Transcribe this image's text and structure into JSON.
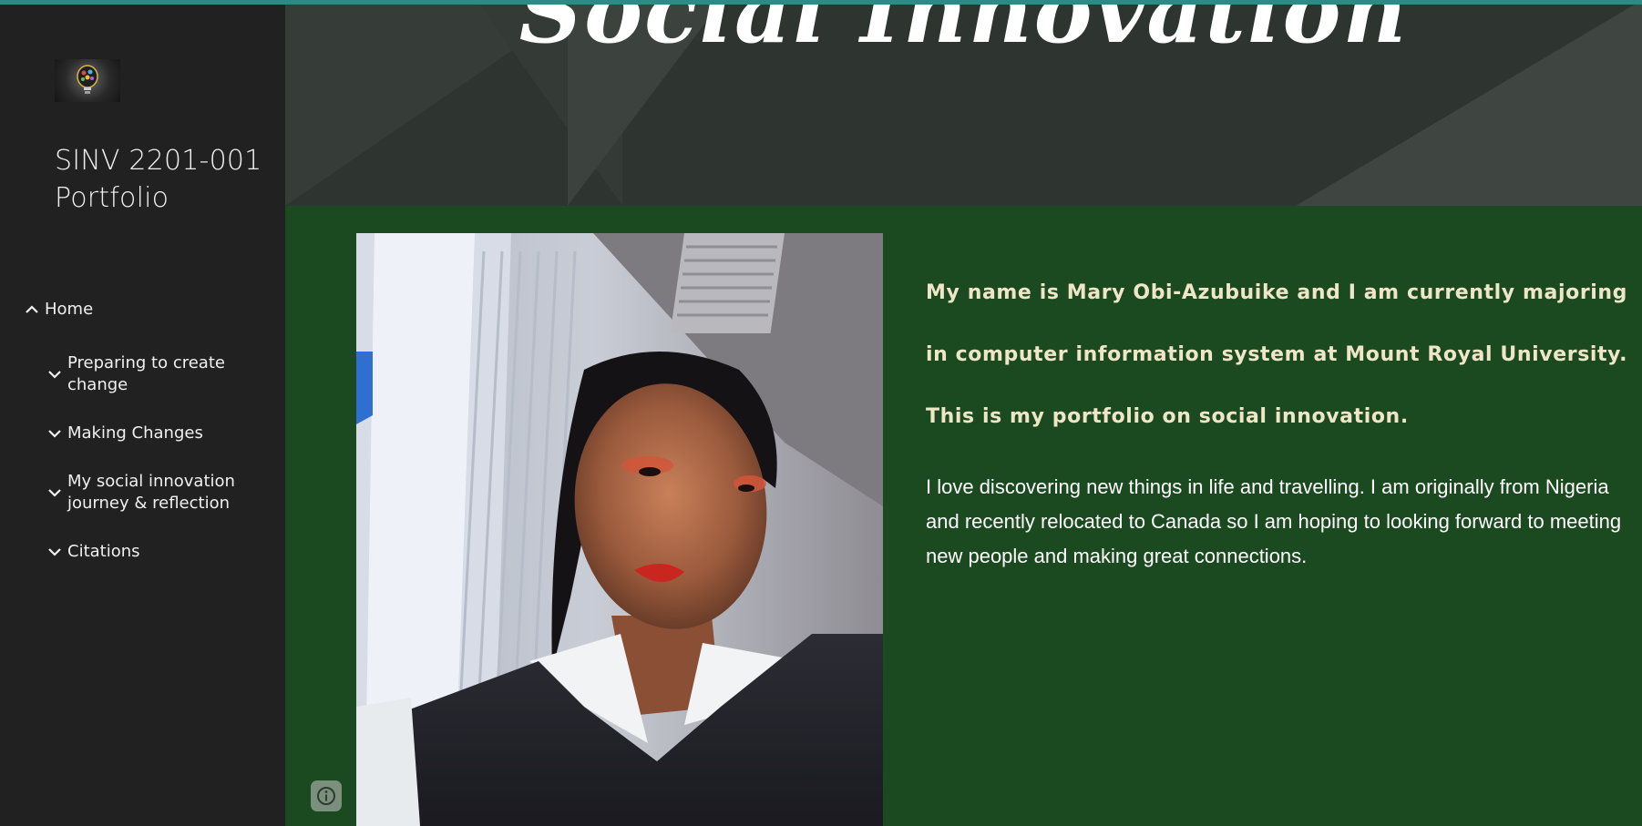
{
  "sidebar": {
    "logo_icon": "lightbulb-logo",
    "site_title": "SINV 2201-001 Portfolio",
    "nav": [
      {
        "label": "Home",
        "icon": "chevron-up-icon",
        "expanded": true
      },
      {
        "label": "Preparing to create change",
        "icon": "chevron-down-icon"
      },
      {
        "label": "Making Changes",
        "icon": "chevron-down-icon"
      },
      {
        "label": "My social innovation journey & reflection",
        "icon": "chevron-down-icon"
      },
      {
        "label": "Citations",
        "icon": "chevron-down-icon"
      }
    ]
  },
  "hero": {
    "title": "Social Innovation"
  },
  "main": {
    "intro_bold": "My name is Mary Obi-Azubuike and I am currently majoring in computer information system at Mount Royal University. This is my portfolio on social innovation.",
    "intro_body": "I love discovering new things in life and travelling. I am originally from Nigeria and recently relocated to Canada so I am hoping to looking forward to meeting new people and making great connections.",
    "photo_icon": "portrait-photo"
  },
  "footer": {
    "info_icon": "info-icon"
  },
  "colors": {
    "sidebar_bg": "#212121",
    "content_bg": "#1c4a20",
    "hero_bg": "#2e342f",
    "accent_line": "#2d8a86",
    "bold_text": "#efe6c8"
  }
}
